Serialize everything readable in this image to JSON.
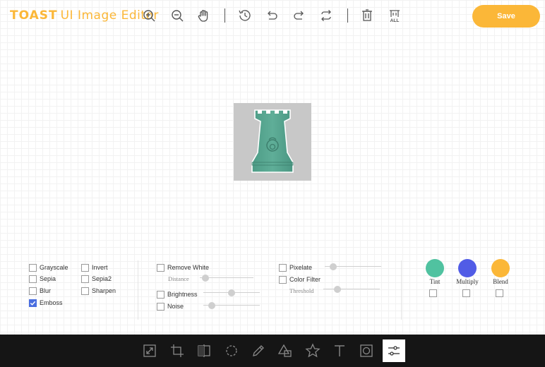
{
  "header": {
    "logo_brand": "TOAST",
    "logo_rest": "UI Image Editor",
    "save_label": "Save"
  },
  "toolbar_icons": [
    "zoom-in-icon",
    "zoom-out-icon",
    "hand-icon",
    "history-icon",
    "undo-icon",
    "redo-icon",
    "reset-icon",
    "delete-icon",
    "delete-all-icon"
  ],
  "filters": {
    "grayscale": "Grayscale",
    "invert": "Invert",
    "sepia": "Sepia",
    "sepia2": "Sepia2",
    "blur": "Blur",
    "sharpen": "Sharpen",
    "emboss": "Emboss",
    "remove_white": "Remove White",
    "distance": "Distance",
    "brightness": "Brightness",
    "noise": "Noise",
    "pixelate": "Pixelate",
    "color_filter": "Color Filter",
    "threshold": "Threshold",
    "tint": "Tint",
    "multiply": "Multiply",
    "blend": "Blend",
    "checked": [
      "emboss"
    ],
    "slider_levels": {
      "distance": 0.1,
      "brightness": 0.5,
      "noise": 0.15,
      "pixelate": 0.15,
      "threshold": 0.25
    }
  },
  "colors": {
    "accent": "#fbb738",
    "tint": "#50c2a0",
    "multiply": "#515ce6",
    "blend": "#fbb738",
    "checkbox_checked": "#4a6ee0",
    "bottombar": "#151515"
  },
  "bottom_tools": [
    "resize-icon",
    "crop-icon",
    "flip-icon",
    "rotate-icon",
    "draw-icon",
    "shape-icon",
    "icon-tool-icon",
    "text-icon",
    "mask-icon",
    "filter-icon"
  ],
  "active_tool": "filter-icon"
}
